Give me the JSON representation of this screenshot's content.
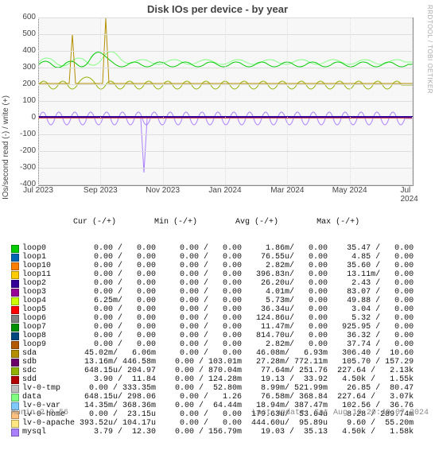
{
  "title": "Disk IOs per device - by year",
  "ylabel": "IOs/second read (-) / write (+)",
  "watermark": "RRDTOOL / TOBI OETIKER",
  "footer_left": "Munin 2.0.56",
  "footer_right": "Last update: Sat Aug 10 20:40:07 2024",
  "chart_data": {
    "type": "line",
    "x_ticks": [
      "Jul 2023",
      "Sep 2023",
      "Nov 2023",
      "Jan 2024",
      "Mar 2024",
      "May 2024",
      "Jul 2024"
    ],
    "y_ticks": [
      -400,
      -300,
      -200,
      -100,
      0,
      100,
      200,
      300,
      400,
      500,
      600
    ],
    "ylim": [
      -400,
      600
    ],
    "header": "             Cur (-/+)        Min (-/+)        Avg (-/+)        Max (-/+)",
    "series": [
      {
        "name": "loop0",
        "color": "#00cc00",
        "cur": "0.00 /   0.00",
        "min": "0.00 /   0.00",
        "avg": "1.86m/   0.00",
        "max": "35.47 /   0.00"
      },
      {
        "name": "loop1",
        "color": "#0066b3",
        "cur": "0.00 /   0.00",
        "min": "0.00 /   0.00",
        "avg": "76.55u/   0.00",
        "max": "4.85 /   0.00"
      },
      {
        "name": "loop10",
        "color": "#ff8000",
        "cur": "0.00 /   0.00",
        "min": "0.00 /   0.00",
        "avg": "2.82m/   0.00",
        "max": "35.60 /   0.00"
      },
      {
        "name": "loop11",
        "color": "#ffcc00",
        "cur": "0.00 /   0.00",
        "min": "0.00 /   0.00",
        "avg": "396.83n/   0.00",
        "max": "13.11m/   0.00"
      },
      {
        "name": "loop2",
        "color": "#330099",
        "cur": "0.00 /   0.00",
        "min": "0.00 /   0.00",
        "avg": "26.20u/   0.00",
        "max": "2.43 /   0.00"
      },
      {
        "name": "loop3",
        "color": "#990099",
        "cur": "0.00 /   0.00",
        "min": "0.00 /   0.00",
        "avg": "4.01m/   0.00",
        "max": "83.07 /   0.00"
      },
      {
        "name": "loop4",
        "color": "#ccff00",
        "cur": "6.25m/   0.00",
        "min": "0.00 /   0.00",
        "avg": "5.73m/   0.00",
        "max": "49.88 /   0.00"
      },
      {
        "name": "loop5",
        "color": "#ff0000",
        "cur": "0.00 /   0.00",
        "min": "0.00 /   0.00",
        "avg": "36.34u/   0.00",
        "max": "3.04 /   0.00"
      },
      {
        "name": "loop6",
        "color": "#808080",
        "cur": "0.00 /   0.00",
        "min": "0.00 /   0.00",
        "avg": "124.86u/   0.00",
        "max": "5.32 /   0.00"
      },
      {
        "name": "loop7",
        "color": "#008f00",
        "cur": "0.00 /   0.00",
        "min": "0.00 /   0.00",
        "avg": "11.47m/   0.00",
        "max": "925.95 /   0.00"
      },
      {
        "name": "loop8",
        "color": "#00487d",
        "cur": "0.00 /   0.00",
        "min": "0.00 /   0.00",
        "avg": "814.70u/   0.00",
        "max": "36.32 /   0.00"
      },
      {
        "name": "loop9",
        "color": "#b35a00",
        "cur": "0.00 /   0.00",
        "min": "0.00 /   0.00",
        "avg": "2.82m/   0.00",
        "max": "37.74 /   0.00"
      },
      {
        "name": "sda",
        "color": "#b38f00",
        "cur": "45.02m/   6.06m",
        "min": "0.00 /   0.00",
        "avg": "46.08m/   6.93m",
        "max": "306.40 /  10.60"
      },
      {
        "name": "sdb",
        "color": "#6b006b",
        "cur": "13.16m/ 446.58m",
        "min": "0.00 / 103.01m",
        "avg": "27.28m/ 772.11m",
        "max": "105.70 / 157.29"
      },
      {
        "name": "sdc",
        "color": "#8fb300",
        "cur": "648.15u/ 204.97",
        "min": "0.00 / 870.04m",
        "avg": "77.64m/ 251.76",
        "max": "227.64 /   2.13k"
      },
      {
        "name": "sdd",
        "color": "#b30000",
        "cur": "3.90 /  11.84",
        "min": "0.00 / 124.28m",
        "avg": "19.13 /  33.92",
        "max": "4.50k /   1.55k"
      },
      {
        "name": "lv-0-tmp",
        "color": "#bebebe",
        "cur": "0.00 / 333.35m",
        "min": "0.00 /  52.80m",
        "avg": "8.99m/ 521.99m",
        "max": "26.85 /  80.47"
      },
      {
        "name": "data",
        "color": "#80ff80",
        "cur": "648.15u/ 298.06",
        "min": "0.00 /   1.26",
        "avg": "76.58m/ 368.84",
        "max": "227.64 /   3.07k"
      },
      {
        "name": "lv-0-var",
        "color": "#80c9ff",
        "cur": "14.35m/ 368.36m",
        "min": "0.00 /  64.44m",
        "avg": "18.94m/ 387.47m",
        "max": "102.56 /  36.76"
      },
      {
        "name": "lv-0-home",
        "color": "#ffc080",
        "cur": "0.00 /  23.15u",
        "min": "0.00 /   0.00",
        "avg": "179.63u/  53.64u",
        "max": "8.28 / 289.74m"
      },
      {
        "name": "lv-0-apache",
        "color": "#ffe680",
        "cur": "393.52u/ 104.17u",
        "min": "0.00 /   0.00",
        "avg": "444.60u/  95.89u",
        "max": "9.60 /  55.20m"
      },
      {
        "name": "mysql",
        "color": "#aa80ff",
        "cur": "3.79 /  12.30",
        "min": "0.00 / 156.79m",
        "avg": "19.03 /  35.13",
        "max": "4.50k /   1.58k"
      }
    ]
  }
}
